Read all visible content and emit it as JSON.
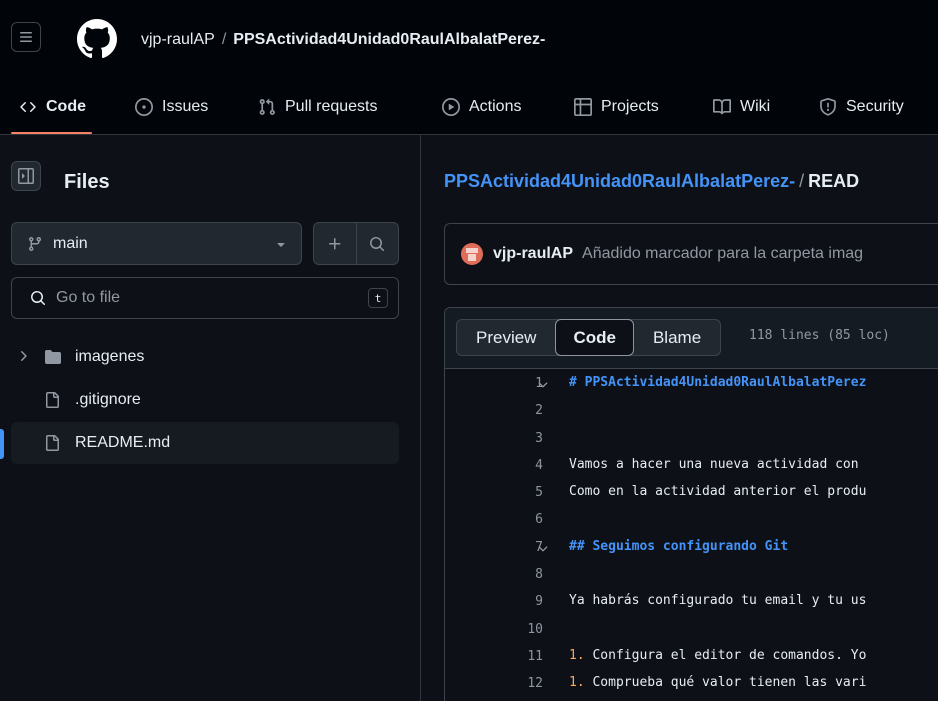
{
  "header": {
    "owner": "vjp-raulAP",
    "separator": "/",
    "repo": "PPSActividad4Unidad0RaulAlbalatPerez-"
  },
  "nav_tabs": [
    {
      "label": "Code",
      "icon": "code-icon",
      "active": true
    },
    {
      "label": "Issues",
      "icon": "issue-opened-icon"
    },
    {
      "label": "Pull requests",
      "icon": "git-pull-request-icon"
    },
    {
      "label": "Actions",
      "icon": "play-icon"
    },
    {
      "label": "Projects",
      "icon": "table-icon"
    },
    {
      "label": "Wiki",
      "icon": "book-icon"
    },
    {
      "label": "Security",
      "icon": "shield-icon"
    }
  ],
  "sidebar": {
    "title": "Files",
    "branch": "main",
    "search_placeholder": "Go to file",
    "search_shortcut": "t",
    "tree": [
      {
        "name": "imagenes",
        "type": "folder"
      },
      {
        "name": ".gitignore",
        "type": "file"
      },
      {
        "name": "README.md",
        "type": "file",
        "selected": true
      }
    ]
  },
  "main": {
    "breadcrumb_repo": "PPSActividad4Unidad0RaulAlbalatPerez-",
    "breadcrumb_sep": "/",
    "breadcrumb_file": "READ",
    "commit_author": "vjp-raulAP",
    "commit_message": "Añadido marcador para la carpeta imag",
    "view_tabs": [
      "Preview",
      "Code",
      "Blame"
    ],
    "active_view": "Code",
    "file_meta": "118 lines (85 loc)",
    "lines": [
      {
        "n": "1",
        "text": "# PPSActividad4Unidad0RaulAlbalatPerez",
        "heading": true,
        "fold": true
      },
      {
        "n": "2",
        "text": ""
      },
      {
        "n": "3",
        "text": ""
      },
      {
        "n": "4",
        "text": "Vamos a hacer una nueva actividad con"
      },
      {
        "n": "5",
        "text": "Como en la actividad anterior el produ"
      },
      {
        "n": "6",
        "text": ""
      },
      {
        "n": "7",
        "text": "## Seguimos configurando Git",
        "heading": true,
        "fold": true
      },
      {
        "n": "8",
        "text": ""
      },
      {
        "n": "9",
        "text": "Ya habrás configurado tu email y tu us"
      },
      {
        "n": "10",
        "text": ""
      },
      {
        "n": "11",
        "marker": "1.",
        "text": " Configura el editor de comandos. Yo"
      },
      {
        "n": "12",
        "marker": "1.",
        "text": " Comprueba qué valor tienen las vari"
      }
    ]
  },
  "colors": {
    "accent_blue": "#4493f8",
    "tab_underline": "#f78166",
    "background": "#0d1117"
  }
}
